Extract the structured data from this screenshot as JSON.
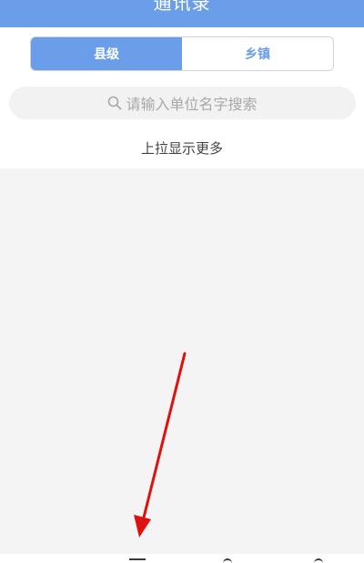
{
  "header": {
    "title": "通讯录"
  },
  "segments": {
    "county_label": "县级",
    "township_label": "乡镇"
  },
  "search": {
    "placeholder": "请输入单位名字搜索"
  },
  "list": {
    "load_more_hint": "上拉显示更多"
  },
  "colors": {
    "accent": "#6b9ee8",
    "annotation_arrow": "#e01010"
  }
}
